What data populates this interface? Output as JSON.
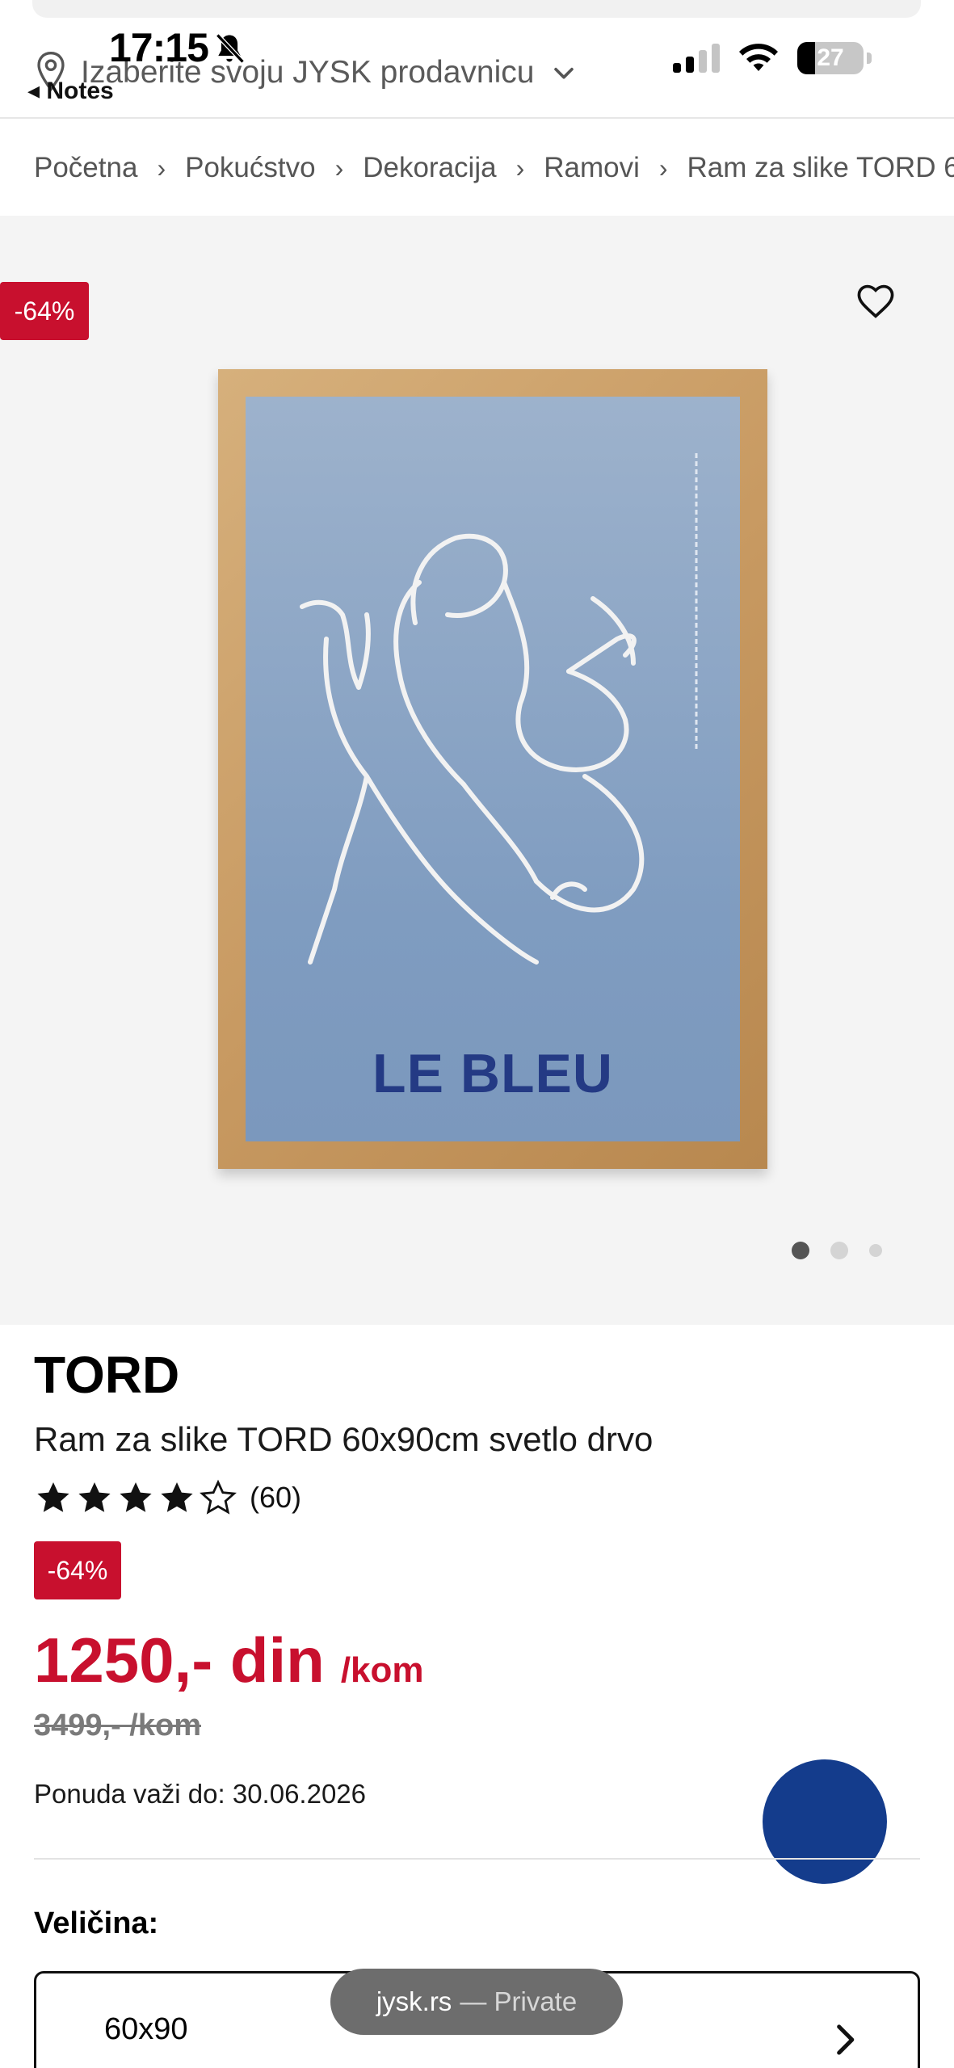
{
  "status_bar": {
    "time": "17:15",
    "back_label": "◂ Notes",
    "battery": "27"
  },
  "header": {
    "store_label": "Izaberite svoju JYSK prodavnicu"
  },
  "breadcrumb": {
    "items": [
      "Početna",
      "Pokućstvo",
      "Dekoracija",
      "Ramovi",
      "Ram za slike TORD 6"
    ]
  },
  "gallery": {
    "discount_badge": "-64%",
    "poster_title": "LE BLEU",
    "slide_count": 3,
    "active_slide": 1
  },
  "product": {
    "brand": "TORD",
    "title": "Ram za slike TORD 60x90cm svetlo drvo",
    "rating_value": 4,
    "rating_max": 5,
    "rating_count": "(60)",
    "discount_badge": "-64%",
    "price": "1250,- din",
    "price_unit": "/kom",
    "old_price": "3499,- /kom",
    "offer_valid": "Ponuda važi do: 30.06.2026"
  },
  "size": {
    "label": "Veličina:",
    "value": "60x90"
  },
  "browser": {
    "domain": "jysk.rs",
    "mode": "— Private"
  },
  "colors": {
    "accent_red": "#c8102e",
    "chat_blue": "#143c8c"
  }
}
